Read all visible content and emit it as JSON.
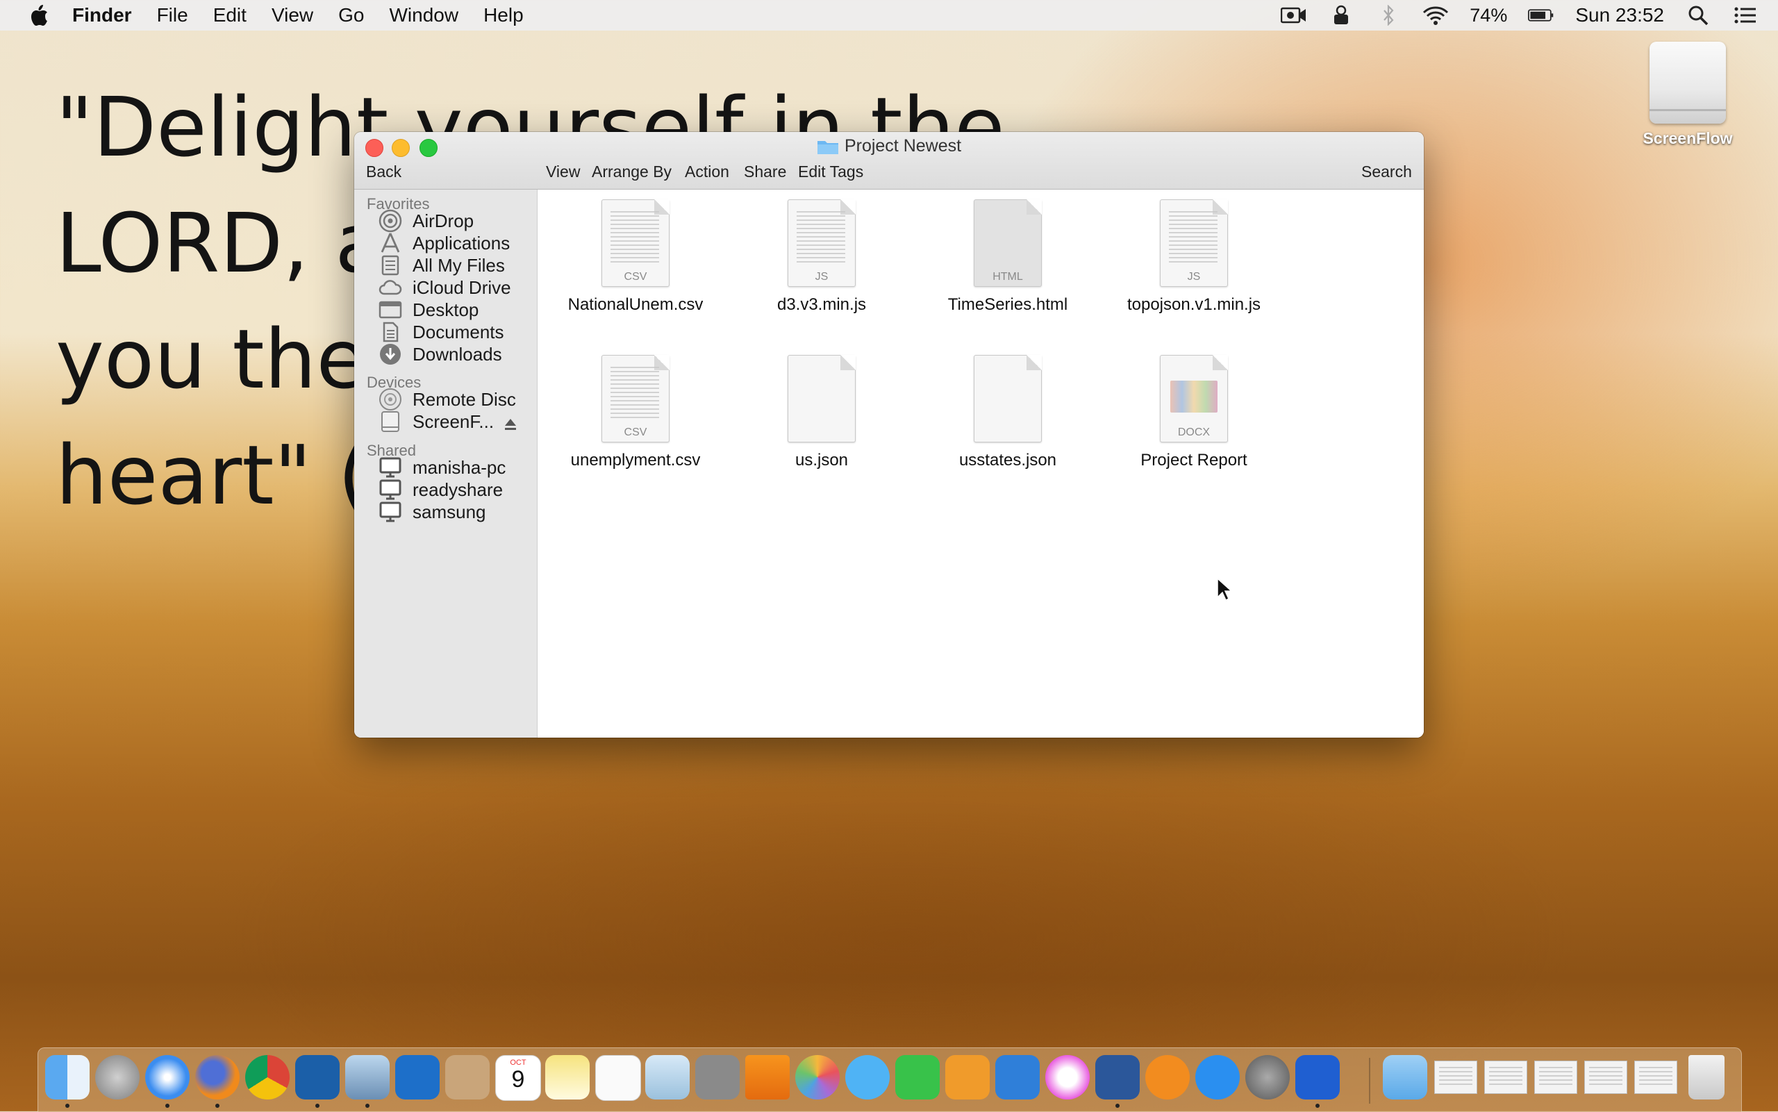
{
  "menubar": {
    "app_name": "Finder",
    "menus": [
      "File",
      "Edit",
      "View",
      "Go",
      "Window",
      "Help"
    ],
    "battery_percent": "74%",
    "clock": "Sun 23:52"
  },
  "desktop": {
    "quote_lines": [
      "\"Delight yourself in the",
      "LORD, a",
      "you the",
      "heart\" (F"
    ],
    "disk_label": "ScreenFlow"
  },
  "window": {
    "title": "Project Newest",
    "toolbar": {
      "back": "Back",
      "view": "View",
      "arrange_by": "Arrange By",
      "action": "Action",
      "share": "Share",
      "edit_tags": "Edit Tags",
      "search": "Search"
    },
    "sidebar": {
      "favorites_header": "Favorites",
      "favorites": [
        {
          "label": "AirDrop",
          "icon": "airdrop-icon"
        },
        {
          "label": "Applications",
          "icon": "applications-icon"
        },
        {
          "label": "All My Files",
          "icon": "all-my-files-icon"
        },
        {
          "label": "iCloud Drive",
          "icon": "icloud-icon"
        },
        {
          "label": "Desktop",
          "icon": "desktop-icon"
        },
        {
          "label": "Documents",
          "icon": "documents-icon"
        },
        {
          "label": "Downloads",
          "icon": "downloads-icon"
        }
      ],
      "devices_header": "Devices",
      "devices": [
        {
          "label": "Remote Disc",
          "icon": "disc-icon"
        },
        {
          "label": "ScreenF...",
          "icon": "drive-icon"
        }
      ],
      "shared_header": "Shared",
      "shared": [
        {
          "label": "manisha-pc",
          "icon": "computer-icon"
        },
        {
          "label": "readyshare",
          "icon": "computer-icon"
        },
        {
          "label": "samsung",
          "icon": "computer-icon"
        }
      ]
    },
    "files": [
      {
        "name": "NationalUnem.csv",
        "ext": "CSV"
      },
      {
        "name": "d3.v3.min.js",
        "ext": "JS"
      },
      {
        "name": "TimeSeries.html",
        "ext": "HTML"
      },
      {
        "name": "topojson.v1.min.js",
        "ext": "JS"
      },
      {
        "name": "unemplyment.csv",
        "ext": "CSV"
      },
      {
        "name": "us.json",
        "ext": ""
      },
      {
        "name": "usstates.json",
        "ext": ""
      },
      {
        "name": "Project Report",
        "ext": "DOCX"
      }
    ]
  },
  "dock": {
    "calendar_month": "OCT",
    "calendar_day": "9",
    "apps": [
      "finder-icon",
      "launchpad-icon",
      "safari-icon",
      "firefox-icon",
      "chrome-icon",
      "app-icon",
      "mail-bird-icon",
      "outlook-icon",
      "contacts-icon",
      "calendar-icon",
      "notes-icon",
      "reminders-icon",
      "preview-icon",
      "calculator-icon",
      "vlc-icon",
      "photos-icon",
      "messages-icon",
      "facetime-icon",
      "pages-icon",
      "keynote-icon",
      "itunes-icon",
      "word-icon",
      "ibooks-icon",
      "appstore-icon",
      "system-preferences-icon",
      "screenflow-icon"
    ]
  }
}
